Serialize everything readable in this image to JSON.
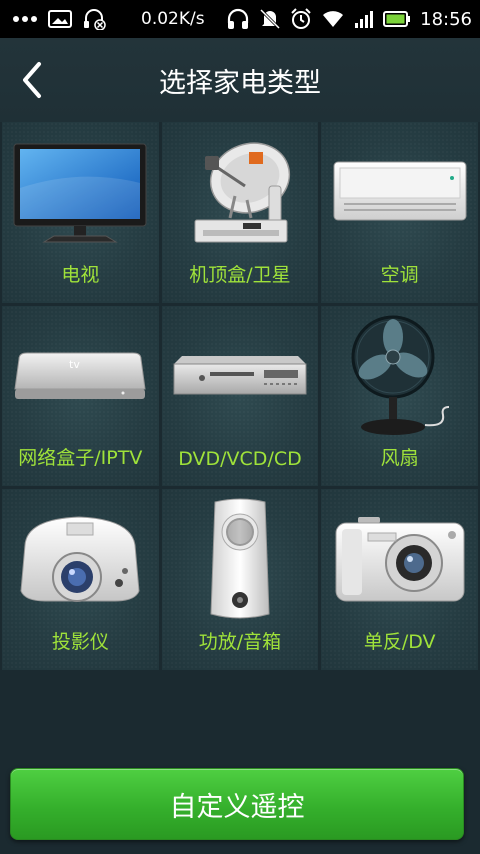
{
  "status_bar": {
    "speed": "0.02K/s",
    "time": "18:56",
    "icons": [
      "more-icon",
      "image-icon",
      "headset-blocked-icon",
      "headphones-icon",
      "mute-icon",
      "alarm-icon",
      "wifi-icon",
      "signal-icon",
      "battery-icon"
    ],
    "battery_color": "#7bd23a"
  },
  "header": {
    "title": "选择家电类型"
  },
  "devices": [
    {
      "label": "电视",
      "icon": "tv-icon"
    },
    {
      "label": "机顶盒/卫星",
      "icon": "satellite-box-icon"
    },
    {
      "label": "空调",
      "icon": "air-conditioner-icon"
    },
    {
      "label": "网络盒子/IPTV",
      "icon": "network-box-icon",
      "badge": "tv"
    },
    {
      "label": "DVD/VCD/CD",
      "icon": "dvd-player-icon"
    },
    {
      "label": "风扇",
      "icon": "fan-icon"
    },
    {
      "label": "投影仪",
      "icon": "projector-icon"
    },
    {
      "label": "功放/音箱",
      "icon": "speaker-icon"
    },
    {
      "label": "单反/DV",
      "icon": "camera-icon"
    }
  ],
  "custom_button": {
    "label": "自定义遥控"
  },
  "colors": {
    "label_green": "#9fe23a",
    "button_green": "#35b02c",
    "background": "#1b2a30"
  }
}
